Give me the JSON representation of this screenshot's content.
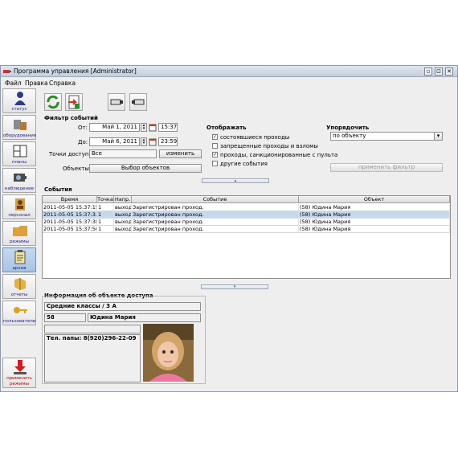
{
  "window": {
    "title": "Программа управления [Administrator]",
    "controls": [
      "▫",
      "⊡",
      "✕"
    ]
  },
  "menu": [
    "Файл",
    "Правка",
    "Справка"
  ],
  "sidebar": {
    "items": [
      {
        "label": "статус",
        "icon": "person-icon"
      },
      {
        "label": "оборудование",
        "icon": "hardware-icon"
      },
      {
        "label": "планы",
        "icon": "floorplan-icon"
      },
      {
        "label": "наблюдение",
        "icon": "camera-icon"
      },
      {
        "label": "персонал",
        "icon": "staff-icon"
      },
      {
        "label": "режимы",
        "icon": "folder-icon"
      },
      {
        "label": "архив",
        "icon": "clipboard-icon"
      },
      {
        "label": "отчеты",
        "icon": "reports-icon"
      },
      {
        "label": "пользователи",
        "icon": "key-icon"
      }
    ],
    "apply": {
      "label_1": "применить",
      "label_2": "режимы",
      "icon": "download-arrow-icon"
    }
  },
  "filter": {
    "title": "Фильтр событий",
    "from_label": "От:",
    "from_date": "Май 1, 2011",
    "from_time": "15:37",
    "to_label": "До:",
    "to_date": "Май 6, 2011",
    "to_time": "23:59",
    "points_label": "Точки доступа:",
    "points_value": "Все",
    "change_button": "изменить",
    "objects_label": "Объекты:",
    "objects_button": "Выбор объектов",
    "show_title": "Отображать",
    "options": [
      {
        "label": "состоявшиеся проходы",
        "checked": true
      },
      {
        "label": "запрещенные проходы и взломы",
        "checked": false
      },
      {
        "label": "проходы, санкционированные с пульта",
        "checked": true
      },
      {
        "label": "другие события",
        "checked": false
      }
    ],
    "sort_title": "Упорядочить",
    "sort_value": "по объекту",
    "apply_button": "применить фильтр"
  },
  "events": {
    "title": "События",
    "columns": [
      "Время",
      "Точка",
      "Напр.",
      "Событие",
      "Объект"
    ],
    "rows": [
      [
        "2011-05-05 15:37:15",
        "1",
        "выход",
        "Зарегистрирован проход.",
        "(58) Юдина Мария"
      ],
      [
        "2011-05-05 15:37:32",
        "1",
        "выход",
        "Зарегистрирован проход.",
        "(58) Юдина Мария"
      ],
      [
        "2011-05-05 15:37:38",
        "1",
        "выход",
        "Зарегистрирован проход.",
        "(58) Юдина Мария"
      ],
      [
        "2011-05-05 15:37:50",
        "1",
        "выход",
        "Зарегистрирован проход.",
        "(58) Юдина Мария"
      ]
    ],
    "selected_row": 1
  },
  "info": {
    "title": "Информация об объекте доступа",
    "group": "Средние классы / 3 А",
    "id": "58",
    "name": "Юдина Мария",
    "empty_field": "",
    "note": "Тел. папы: 8(920)296-22-09"
  },
  "colors": {
    "accent": "#a9c3e3",
    "selection": "#c6d8ee",
    "apply_text": "#b00000"
  }
}
